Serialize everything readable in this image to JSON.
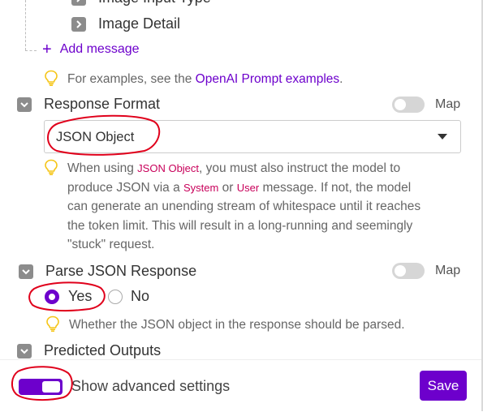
{
  "messages_list": {
    "partial_item": "Image Input Type",
    "item_image_detail": "Image Detail",
    "add_message": "Add message",
    "hint_prefix": "For examples, see the ",
    "hint_link": "OpenAI Prompt examples",
    "hint_suffix": "."
  },
  "response_format": {
    "label": "Response Format",
    "map_label": "Map",
    "map_enabled": false,
    "selected": "JSON Object",
    "hint": {
      "p1": "When using ",
      "c1": "JSON Object",
      "p2": ", you must also instruct the model to",
      "line2a": "produce JSON via a ",
      "c2": "System",
      "p3": " or ",
      "c3": "User",
      "p4": " message. If not, the model",
      "line3": "can generate an unending stream of whitespace until it reaches",
      "line4": "the token limit. This will result in a long-running and seemingly",
      "line5": "\"stuck\" request."
    }
  },
  "parse_json": {
    "label": "Parse JSON Response",
    "map_label": "Map",
    "map_enabled": false,
    "options": [
      "Yes",
      "No"
    ],
    "selected": "Yes",
    "hint": "Whether the JSON object in the response should be parsed."
  },
  "predicted_outputs": {
    "label": "Predicted Outputs"
  },
  "footer": {
    "advanced_label": "Show advanced settings",
    "advanced_enabled": true,
    "save_label": "Save"
  },
  "colors": {
    "accent": "#6d00cc",
    "annotation": "#e0001b",
    "bulb": "#f5c518"
  }
}
